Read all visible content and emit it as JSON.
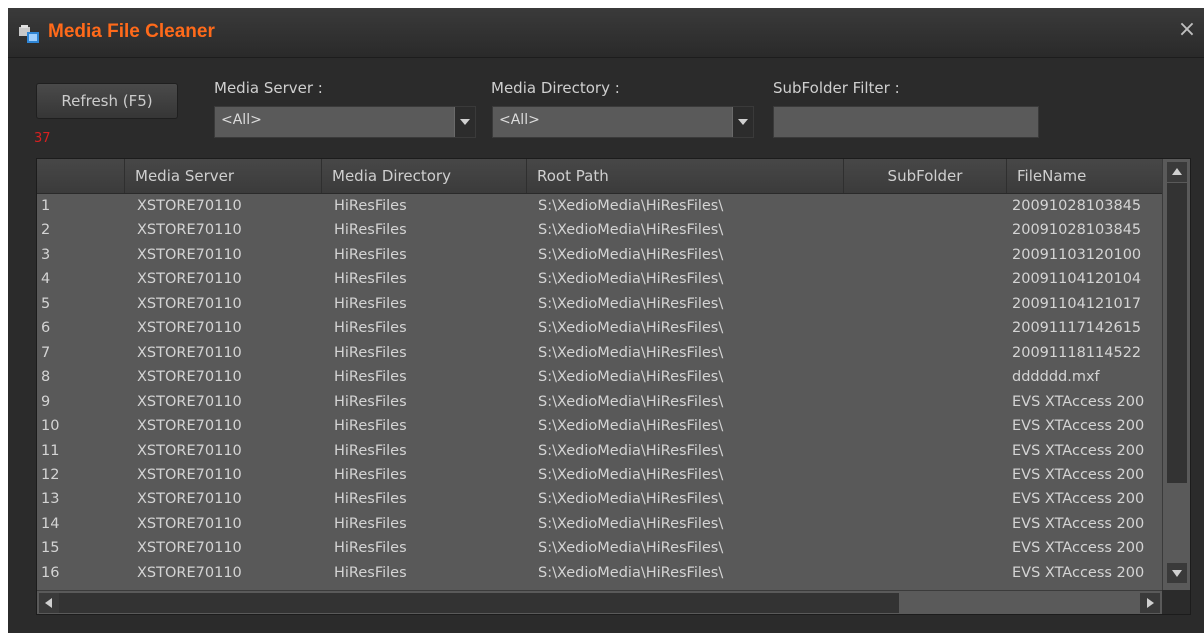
{
  "window": {
    "title": "Media File Cleaner",
    "close_glyph": "×",
    "title_icon": "media-cleaner-icon",
    "accent_color": "#ff6a1a"
  },
  "toolbar": {
    "refresh_label": "Refresh (F5)",
    "count": "37",
    "count_color": "#d82020",
    "media_server_label": "Media Server :",
    "media_server_value": "<All>",
    "media_directory_label": "Media Directory :",
    "media_directory_value": "<All>",
    "subfolder_filter_label": "SubFolder Filter :",
    "subfolder_filter_value": ""
  },
  "grid": {
    "columns": [
      "",
      "Media Server",
      "Media Directory",
      "Root Path",
      "SubFolder",
      "FileName"
    ],
    "rows": [
      {
        "num": "1",
        "server": "XSTORE70110",
        "directory": "HiResFiles",
        "root": "S:\\XedioMedia\\HiResFiles\\",
        "subfolder": "",
        "filename": "20091028103845"
      },
      {
        "num": "2",
        "server": "XSTORE70110",
        "directory": "HiResFiles",
        "root": "S:\\XedioMedia\\HiResFiles\\",
        "subfolder": "",
        "filename": "20091028103845"
      },
      {
        "num": "3",
        "server": "XSTORE70110",
        "directory": "HiResFiles",
        "root": "S:\\XedioMedia\\HiResFiles\\",
        "subfolder": "",
        "filename": "20091103120100"
      },
      {
        "num": "4",
        "server": "XSTORE70110",
        "directory": "HiResFiles",
        "root": "S:\\XedioMedia\\HiResFiles\\",
        "subfolder": "",
        "filename": "20091104120104"
      },
      {
        "num": "5",
        "server": "XSTORE70110",
        "directory": "HiResFiles",
        "root": "S:\\XedioMedia\\HiResFiles\\",
        "subfolder": "",
        "filename": "20091104121017"
      },
      {
        "num": "6",
        "server": "XSTORE70110",
        "directory": "HiResFiles",
        "root": "S:\\XedioMedia\\HiResFiles\\",
        "subfolder": "",
        "filename": "20091117142615"
      },
      {
        "num": "7",
        "server": "XSTORE70110",
        "directory": "HiResFiles",
        "root": "S:\\XedioMedia\\HiResFiles\\",
        "subfolder": "",
        "filename": "20091118114522"
      },
      {
        "num": "8",
        "server": "XSTORE70110",
        "directory": "HiResFiles",
        "root": "S:\\XedioMedia\\HiResFiles\\",
        "subfolder": "",
        "filename": "dddddd.mxf"
      },
      {
        "num": "9",
        "server": "XSTORE70110",
        "directory": "HiResFiles",
        "root": "S:\\XedioMedia\\HiResFiles\\",
        "subfolder": "",
        "filename": "EVS XTAccess 200"
      },
      {
        "num": "10",
        "server": "XSTORE70110",
        "directory": "HiResFiles",
        "root": "S:\\XedioMedia\\HiResFiles\\",
        "subfolder": "",
        "filename": "EVS XTAccess 200"
      },
      {
        "num": "11",
        "server": "XSTORE70110",
        "directory": "HiResFiles",
        "root": "S:\\XedioMedia\\HiResFiles\\",
        "subfolder": "",
        "filename": "EVS XTAccess 200"
      },
      {
        "num": "12",
        "server": "XSTORE70110",
        "directory": "HiResFiles",
        "root": "S:\\XedioMedia\\HiResFiles\\",
        "subfolder": "",
        "filename": "EVS XTAccess 200"
      },
      {
        "num": "13",
        "server": "XSTORE70110",
        "directory": "HiResFiles",
        "root": "S:\\XedioMedia\\HiResFiles\\",
        "subfolder": "",
        "filename": "EVS XTAccess 200"
      },
      {
        "num": "14",
        "server": "XSTORE70110",
        "directory": "HiResFiles",
        "root": "S:\\XedioMedia\\HiResFiles\\",
        "subfolder": "",
        "filename": "EVS XTAccess 200"
      },
      {
        "num": "15",
        "server": "XSTORE70110",
        "directory": "HiResFiles",
        "root": "S:\\XedioMedia\\HiResFiles\\",
        "subfolder": "",
        "filename": "EVS XTAccess 200"
      },
      {
        "num": "16",
        "server": "XSTORE70110",
        "directory": "HiResFiles",
        "root": "S:\\XedioMedia\\HiResFiles\\",
        "subfolder": "",
        "filename": "EVS XTAccess 200"
      }
    ]
  }
}
